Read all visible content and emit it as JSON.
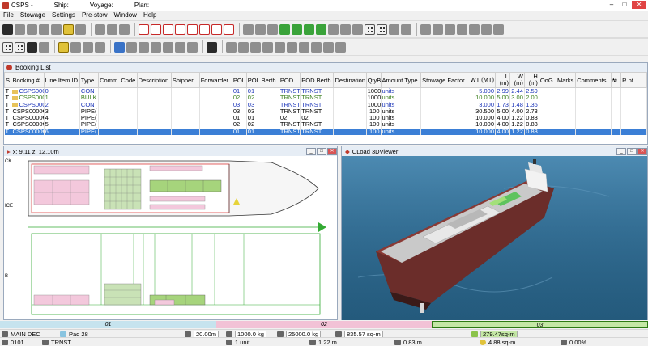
{
  "titlebar": {
    "app": "CSPS -",
    "ship_label": "Ship:",
    "voyage_label": "Voyage:",
    "plan_label": "Plan:"
  },
  "window_controls": {
    "minimize": "–",
    "maximize": "□",
    "close": "✕"
  },
  "menu": [
    "File",
    "Stowage",
    "Settings",
    "Pre-stow",
    "Window",
    "Help"
  ],
  "booking_list": {
    "title": "Booking List",
    "columns": [
      "S",
      "Booking #",
      "Line Item ID",
      "Type",
      "Comm. Code",
      "Description",
      "Shipper",
      "Forwarder",
      "POL",
      "POL Berth",
      "POD",
      "POD Berth",
      "Destination",
      "QtyB",
      "Amount Type",
      "Stowage Factor",
      "WT (MT)",
      "L (m)",
      "W (m)",
      "H (m)",
      "OoG",
      "Marks",
      "Comments",
      "",
      "R pt"
    ],
    "rows": [
      {
        "s": "T",
        "folder": true,
        "booking": "CSPS0000€",
        "line": "0",
        "type": "CON",
        "pol": "01",
        "pol_berth": "01",
        "pod": "TRNST",
        "pod_berth": "TRNST",
        "qty": "1000",
        "amount": "units",
        "wt": "5.000",
        "l": "2.99",
        "w": "2.44",
        "h": "2.59",
        "color": "blue"
      },
      {
        "s": "T",
        "folder": true,
        "booking": "CSPS0000€",
        "line": "1",
        "type": "BULK",
        "pol": "02",
        "pol_berth": "02",
        "pod": "TRNST",
        "pod_berth": "TRNST",
        "qty": "1000",
        "amount": "units",
        "wt": "10.000",
        "l": "5.00",
        "w": "3.00",
        "h": "2.00",
        "color": "green"
      },
      {
        "s": "T",
        "folder": true,
        "booking": "CSPS0000€",
        "line": "2",
        "type": "CON",
        "pol": "03",
        "pol_berth": "03",
        "pod": "TRNST",
        "pod_berth": "TRNST",
        "qty": "1000",
        "amount": "units",
        "wt": "3.000",
        "l": "1.73",
        "w": "1.48",
        "h": "1.36",
        "color": "blue"
      },
      {
        "s": "T",
        "folder": false,
        "booking": "CSPS0000€",
        "line": "3",
        "type": "PIPE(",
        "pol": "03",
        "pol_berth": "03",
        "pod": "TRNST",
        "pod_berth": "TRNST",
        "qty": "100",
        "amount": "units",
        "wt": "30.500",
        "l": "5.00",
        "w": "4.00",
        "h": "2.73",
        "color": "black"
      },
      {
        "s": "T",
        "folder": false,
        "booking": "CSPS0000€",
        "line": "4",
        "type": "PIPE(",
        "pol": "01",
        "pol_berth": "01",
        "pod": "02",
        "pod_berth": "02",
        "qty": "100",
        "amount": "units",
        "wt": "10.000",
        "l": "4.00",
        "w": "1.22",
        "h": "0.83",
        "color": "black"
      },
      {
        "s": "T",
        "folder": false,
        "booking": "CSPS0000€",
        "line": "5",
        "type": "PIPE(",
        "pol": "02",
        "pol_berth": "02",
        "pod": "TRNST",
        "pod_berth": "TRNST",
        "qty": "100",
        "amount": "units",
        "wt": "10.000",
        "l": "4.00",
        "w": "1.22",
        "h": "0.83",
        "color": "black"
      },
      {
        "s": "T",
        "folder": false,
        "booking": "CSPS0000€",
        "line": "6",
        "type": "PIPE(",
        "pol": "01",
        "pol_berth": "01",
        "pod": "TRNST",
        "pod_berth": "TRNST",
        "qty": "100",
        "amount": "units",
        "wt": "10.000",
        "l": "4.00",
        "w": "1.22",
        "h": "0.83",
        "color": "black",
        "selected": true
      }
    ]
  },
  "plan_panel": {
    "coords": "x: 9.11  z: 12.10m",
    "side_label_top": "CK",
    "side_label_mid": "ICE",
    "side_label_bot": "B"
  },
  "viewer_panel": {
    "title": "CLoad 3DViewer"
  },
  "bays": {
    "b1": "01",
    "b2": "02",
    "b3": "03"
  },
  "status1": {
    "deck": "MAIN DEC",
    "pad": "Pad 28",
    "length": "20.00m",
    "weight": "1000.0 kg",
    "capacity": "25000.0 kg",
    "area": "835.57 sq-m",
    "used_area": "279.47sq-m"
  },
  "status2": {
    "id": "0101",
    "pod": "TRNST",
    "units": "1 unit",
    "w": "1.22 m",
    "h": "0.83 m",
    "wt": "4.88 sq-m",
    "pct": "0.00%"
  },
  "colors": {
    "selection": "#3b7fd6",
    "bay1": "#c6e3ee",
    "bay2": "#f2c2d6",
    "bay3": "#c4e7a5",
    "sea": "#2f6a90"
  }
}
